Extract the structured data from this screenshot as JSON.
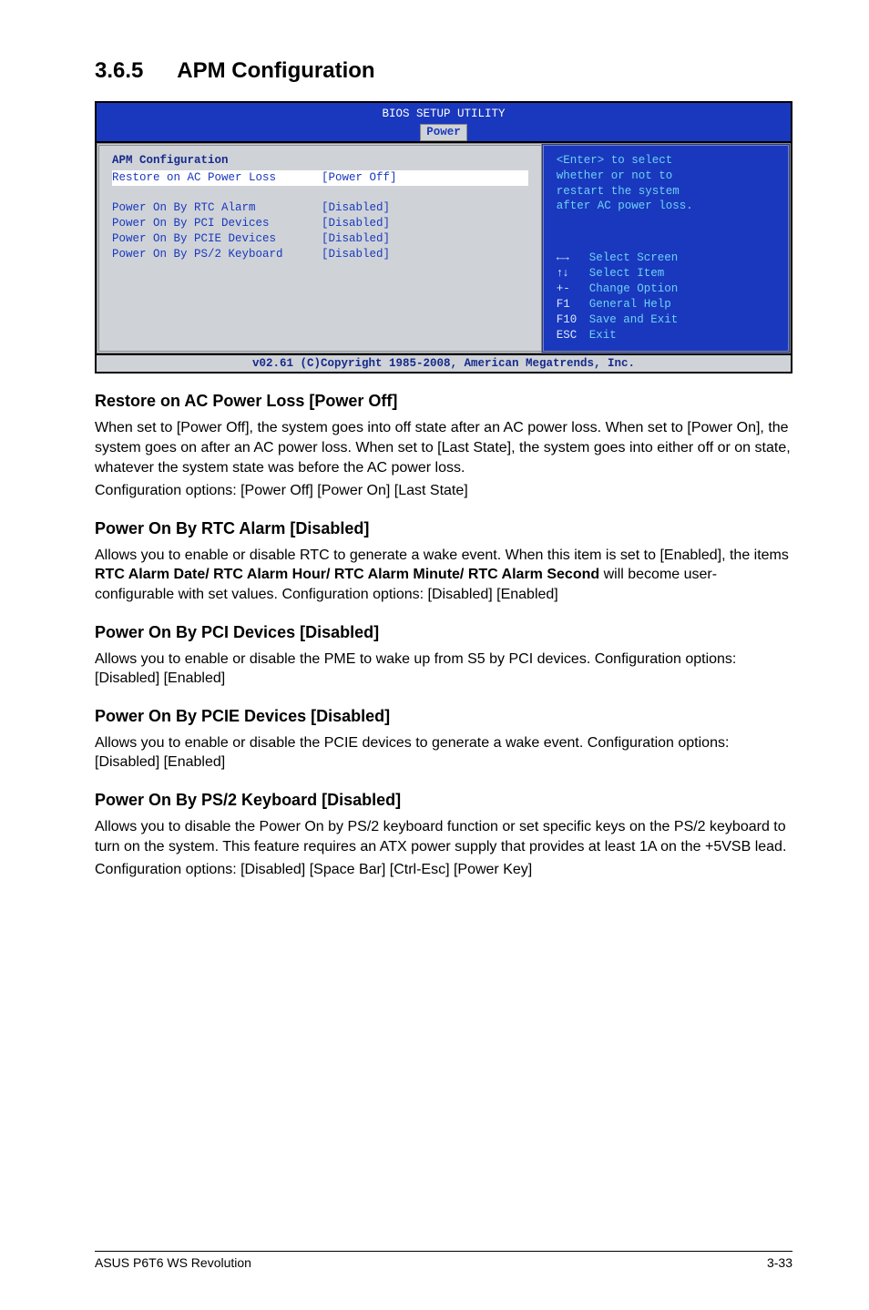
{
  "section": {
    "number": "3.6.5",
    "title": "APM Configuration"
  },
  "bios": {
    "title": "BIOS SETUP UTILITY",
    "tab": "Power",
    "panel_heading": "APM Configuration",
    "items": [
      {
        "label": "Restore on AC Power Loss",
        "value": "[Power Off]",
        "highlight": true,
        "blank_after": true
      },
      {
        "label": "Power On By RTC Alarm",
        "value": "[Disabled]"
      },
      {
        "label": "Power On By PCI Devices",
        "value": "[Disabled]"
      },
      {
        "label": "Power On By PCIE Devices",
        "value": "[Disabled]"
      },
      {
        "label": "Power On By PS/2 Keyboard",
        "value": "[Disabled]"
      }
    ],
    "help": {
      "l1": "<Enter> to select",
      "l2": "whether or not to",
      "l3": "restart the system",
      "l4": "after AC power loss."
    },
    "nav": [
      {
        "key": "←→",
        "desc": "Select Screen",
        "arrows": true
      },
      {
        "key": "↑↓",
        "desc": "Select Item",
        "arrows": true
      },
      {
        "key": "+-",
        "desc": " Change Option"
      },
      {
        "key": "F1",
        "desc": "General Help"
      },
      {
        "key": "F10",
        "desc": "Save and Exit"
      },
      {
        "key": "ESC",
        "desc": "Exit"
      }
    ],
    "footer": "v02.61 (C)Copyright 1985-2008, American Megatrends, Inc."
  },
  "subsections": [
    {
      "heading": "Restore on AC Power Loss [Power Off]",
      "paragraphs": [
        "When set to [Power Off], the system goes into off state after an AC power loss. When set to [Power On], the system goes on after an AC power loss. When set to [Last State], the system goes into either off or on state, whatever the system state was before the AC power loss.",
        "Configuration options: [Power Off] [Power On] [Last State]"
      ]
    },
    {
      "heading": "Power On By RTC Alarm [Disabled]",
      "paragraphs_html": [
        "Allows you to enable or disable RTC to generate a wake event. When this item is set to [Enabled], the items <span class=\"bold\">RTC Alarm Date/ RTC Alarm Hour/ RTC Alarm Minute/ RTC Alarm Second</span> will become user-configurable with set values. Configuration options: [Disabled] [Enabled]"
      ]
    },
    {
      "heading": "Power On By PCI Devices [Disabled]",
      "paragraphs": [
        "Allows you to enable or disable the PME to wake up from S5 by PCI devices. Configuration options: [Disabled] [Enabled]"
      ]
    },
    {
      "heading": "Power On By PCIE Devices [Disabled]",
      "paragraphs": [
        "Allows you to enable or disable the PCIE devices to generate a wake event. Configuration options: [Disabled] [Enabled]"
      ]
    },
    {
      "heading": "Power On By PS/2 Keyboard [Disabled]",
      "paragraphs": [
        "Allows you to disable the Power On by PS/2 keyboard function or set specific keys on the PS/2 keyboard to turn on the system. This feature requires an ATX power supply that provides at least 1A on the +5VSB lead.",
        "Configuration options: [Disabled] [Space Bar] [Ctrl-Esc] [Power Key]"
      ]
    }
  ],
  "footer": {
    "left": "ASUS P6T6 WS Revolution",
    "right": "3-33"
  }
}
